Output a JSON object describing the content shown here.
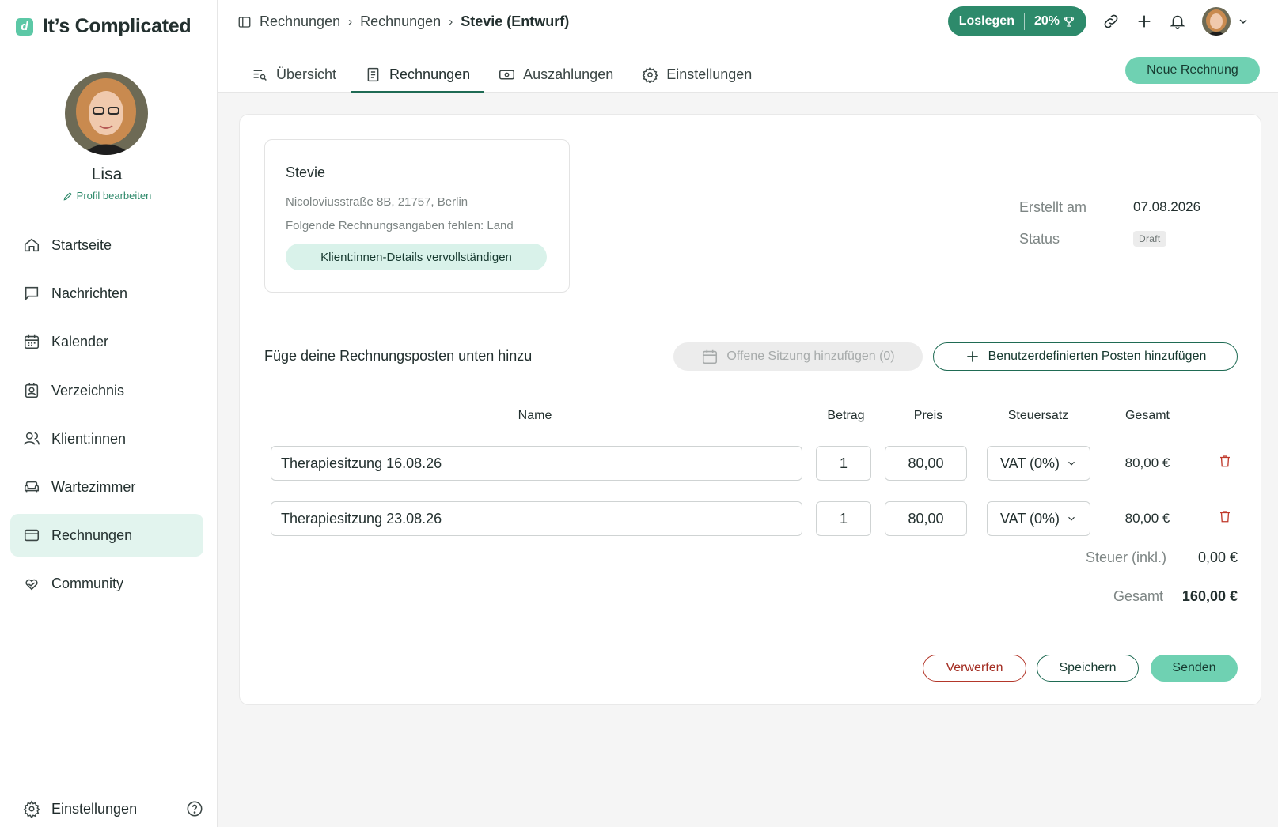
{
  "app": {
    "logo_mark": "d",
    "title": "It’s Complicated"
  },
  "profile": {
    "name": "Lisa",
    "edit_label": "Profil bearbeiten"
  },
  "sidebar": {
    "items": [
      {
        "label": "Startseite",
        "icon": "home-icon"
      },
      {
        "label": "Nachrichten",
        "icon": "chat-icon"
      },
      {
        "label": "Kalender",
        "icon": "calendar-icon"
      },
      {
        "label": "Verzeichnis",
        "icon": "directory-icon"
      },
      {
        "label": "Klient:innen",
        "icon": "users-icon"
      },
      {
        "label": "Wartezimmer",
        "icon": "couch-icon"
      },
      {
        "label": "Rechnungen",
        "icon": "card-icon",
        "active": true
      },
      {
        "label": "Community",
        "icon": "heart-hand-icon"
      }
    ],
    "settings_label": "Einstellungen"
  },
  "header": {
    "breadcrumb": [
      "Rechnungen",
      "Rechnungen",
      "Stevie (Entwurf)"
    ],
    "progress": {
      "label": "Loslegen",
      "percent": "20%"
    }
  },
  "tabs": [
    {
      "label": "Übersicht"
    },
    {
      "label": "Rechnungen",
      "active": true
    },
    {
      "label": "Auszahlungen"
    },
    {
      "label": "Einstellungen"
    }
  ],
  "new_invoice_label": "Neue Rechnung",
  "client": {
    "name": "Stevie",
    "address": "Nicoloviusstraße 8B, 21757, Berlin",
    "missing": "Folgende Rechnungsangaben fehlen: Land",
    "complete_label": "Klient:innen-Details vervollständigen"
  },
  "meta": {
    "created_label": "Erstellt am",
    "created_value": "07.08.2026",
    "status_label": "Status",
    "status_value": "Draft"
  },
  "items_section": {
    "hint": "Füge deine Rechnungsposten unten hinzu",
    "open_session_label": "Offene Sitzung hinzufügen (0)",
    "custom_item_label": "Benutzerdefinierten Posten hinzufügen"
  },
  "table": {
    "headers": {
      "name": "Name",
      "amount": "Betrag",
      "price": "Preis",
      "tax": "Steuersatz",
      "total": "Gesamt"
    },
    "rows": [
      {
        "name": "Therapiesitzung 16.08.26",
        "amount": "1",
        "price": "80,00",
        "tax": "VAT (0%)",
        "total": "80,00 €"
      },
      {
        "name": "Therapiesitzung 23.08.26",
        "amount": "1",
        "price": "80,00",
        "tax": "VAT (0%)",
        "total": "80,00 €"
      }
    ]
  },
  "summary": {
    "tax_label": "Steuer (inkl.)",
    "tax_value": "0,00 €",
    "total_label": "Gesamt",
    "total_value": "160,00 €"
  },
  "actions": {
    "discard": "Verwerfen",
    "save": "Speichern",
    "send": "Senden"
  },
  "colors": {
    "accent": "#6fd1b2",
    "brand_dark": "#2d8a6b",
    "active_nav": "#e2f4ee",
    "danger": "#b3372a"
  }
}
